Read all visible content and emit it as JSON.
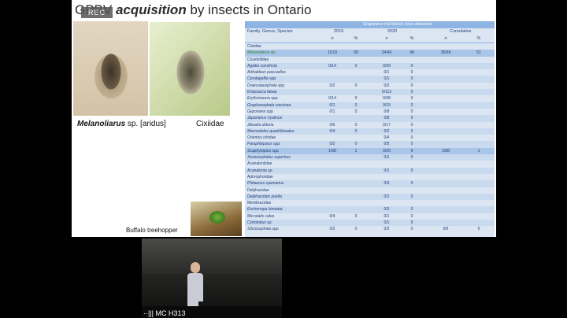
{
  "slide": {
    "title_prefix": "GPBV ",
    "title_emph": "acquisition",
    "title_suffix": " by insects in Ontario",
    "badge": "REC",
    "caption_genus": "Melanoliarus",
    "caption_species": " sp. [aridus]",
    "caption_family": "Cixiidae",
    "caption_hopper": "Buffalo treehopper"
  },
  "table": {
    "title": "Grapevine red blotch virus detection",
    "col_label": "Family, Genus, Species",
    "years": [
      "2019",
      "2020",
      "Cumulative"
    ],
    "sub": [
      "n",
      "%",
      "n",
      "%",
      "n",
      "%"
    ],
    "rows": [
      {
        "name": "Cixiidae",
        "family": true
      },
      {
        "name": "Melanoliarus sp.",
        "v": [
          "11/19",
          "58",
          "24/49",
          "49",
          "35/68",
          "51"
        ],
        "hl": true,
        "green": true
      },
      {
        "name": "Cicadellidae",
        "family": true
      },
      {
        "name": "Agallia constricta",
        "v": [
          "0/14",
          "0",
          "0/99",
          "0",
          "",
          ""
        ]
      },
      {
        "name": "Arthaldeus pascuellus",
        "v": [
          "",
          "",
          "0/1",
          "0",
          "",
          ""
        ]
      },
      {
        "name": "Ceratagallia spp.",
        "v": [
          "",
          "",
          "0/1",
          "0",
          "",
          ""
        ]
      },
      {
        "name": "Draeculacephala spp.",
        "v": [
          "0/2",
          "0",
          "0/2",
          "0",
          "",
          ""
        ]
      },
      {
        "name": "Empoasca fabae",
        "v": [
          "",
          "",
          "0/113",
          "0",
          "",
          ""
        ]
      },
      {
        "name": "Erythroneura spp.",
        "v": [
          "0/14",
          "0",
          "0/38",
          "0",
          "",
          ""
        ]
      },
      {
        "name": "Graphocephala coccinea",
        "v": [
          "0/1",
          "0",
          "0/15",
          "0",
          "",
          ""
        ]
      },
      {
        "name": "Gyponana spp.",
        "v": [
          "0/1",
          "0",
          "0/8",
          "0",
          "",
          ""
        ]
      },
      {
        "name": "Japananus hyalinus",
        "v": [
          "",
          "",
          "0/8",
          "0",
          "",
          ""
        ]
      },
      {
        "name": "Jikradia olitoria",
        "v": [
          "0/6",
          "0",
          "0/17",
          "0",
          "",
          ""
        ]
      },
      {
        "name": "Macrosteles quadrilineatus",
        "v": [
          "0/4",
          "0",
          "0/2",
          "0",
          "",
          ""
        ]
      },
      {
        "name": "Orientus ishidae",
        "v": [
          "",
          "",
          "0/4",
          "0",
          "",
          ""
        ]
      },
      {
        "name": "Paraphlepsius spp.",
        "v": [
          "0/2",
          "0",
          "0/5",
          "0",
          "",
          ""
        ]
      },
      {
        "name": "Scaphytopius spp.",
        "v": [
          "1/68",
          "1",
          "0/20",
          "0",
          "1/88",
          "1"
        ],
        "hl": true
      },
      {
        "name": "Xestocephalus superbus",
        "v": [
          "",
          "",
          "0/1",
          "0",
          "",
          ""
        ]
      },
      {
        "name": "Acanaloniidae",
        "family": true
      },
      {
        "name": "Acanalonia sp.",
        "v": [
          "",
          "",
          "0/1",
          "0",
          "",
          ""
        ]
      },
      {
        "name": "Aphrophoridae",
        "family": true
      },
      {
        "name": "Philaenus spumarius",
        "v": [
          "",
          "",
          "0/3",
          "0",
          "",
          ""
        ]
      },
      {
        "name": "Delphacidae",
        "family": true
      },
      {
        "name": "Delphacodes puella",
        "v": [
          "",
          "",
          "0/1",
          "0",
          "",
          ""
        ]
      },
      {
        "name": "Membracidae",
        "family": true
      },
      {
        "name": "Enchenopa binotata",
        "v": [
          "",
          "",
          "0/3",
          "0",
          "",
          ""
        ]
      },
      {
        "name": "Micrutalis calva",
        "v": [
          "0/4",
          "0",
          "0/1",
          "0",
          "",
          ""
        ]
      },
      {
        "name": "Cyrtolobus sp.",
        "v": [
          "",
          "",
          "0/1",
          "0",
          "",
          ""
        ]
      },
      {
        "name": "Stictocephala spp.",
        "v": [
          "0/2",
          "0",
          "0/3",
          "0",
          "0/5",
          "0"
        ]
      }
    ]
  },
  "video": {
    "room_label": "MC H313"
  }
}
